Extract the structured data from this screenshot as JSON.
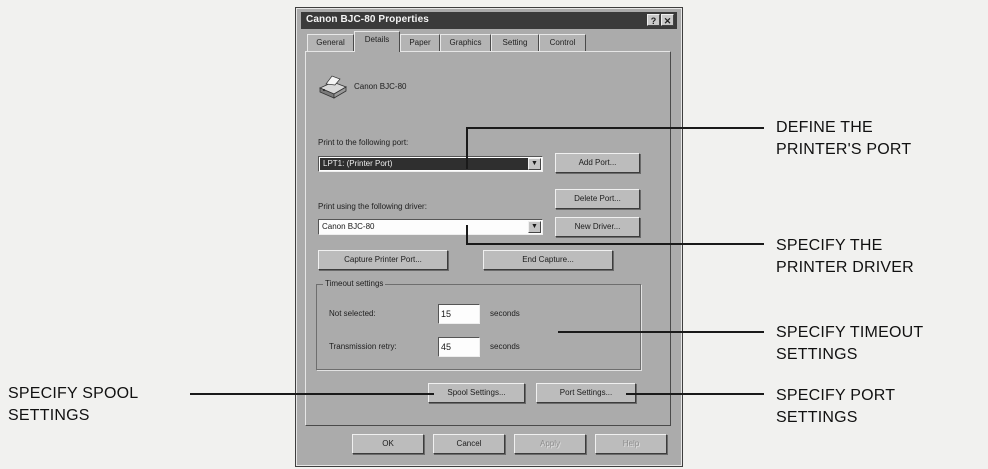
{
  "window": {
    "title": "Canon BJC-80 Properties",
    "help_button": "?",
    "close_button": "✕"
  },
  "tabs": [
    {
      "label": "General"
    },
    {
      "label": "Details",
      "active": true
    },
    {
      "label": "Paper"
    },
    {
      "label": "Graphics"
    },
    {
      "label": "Setting"
    },
    {
      "label": "Control"
    }
  ],
  "printer": {
    "name": "Canon BJC-80",
    "icon": "printer-icon"
  },
  "port": {
    "label": "Print to the following port:",
    "value": "LPT1: (Printer Port)",
    "add_button": "Add Port...",
    "delete_button": "Delete Port..."
  },
  "driver": {
    "label": "Print using the following driver:",
    "value": "Canon BJC-80",
    "new_button": "New Driver..."
  },
  "capture": {
    "capture_button": "Capture Printer Port...",
    "end_button": "End Capture..."
  },
  "timeout": {
    "legend": "Timeout settings",
    "not_selected_label": "Not selected:",
    "not_selected_value": "15",
    "transmission_label": "Transmission retry:",
    "transmission_value": "45",
    "unit": "seconds"
  },
  "spool_button": "Spool Settings...",
  "port_settings_button": "Port Settings...",
  "footer": {
    "ok": "OK",
    "cancel": "Cancel",
    "apply": "Apply",
    "help": "Help"
  },
  "callouts": {
    "port": [
      "DEFINE THE",
      "PRINTER'S PORT"
    ],
    "driver": [
      "SPECIFY THE",
      "PRINTER DRIVER"
    ],
    "timeout": [
      "SPECIFY TIMEOUT",
      "SETTINGS"
    ],
    "port_settings": [
      "SPECIFY PORT",
      "SETTINGS"
    ],
    "spool": [
      "SPECIFY SPOOL",
      "SETTINGS"
    ]
  }
}
